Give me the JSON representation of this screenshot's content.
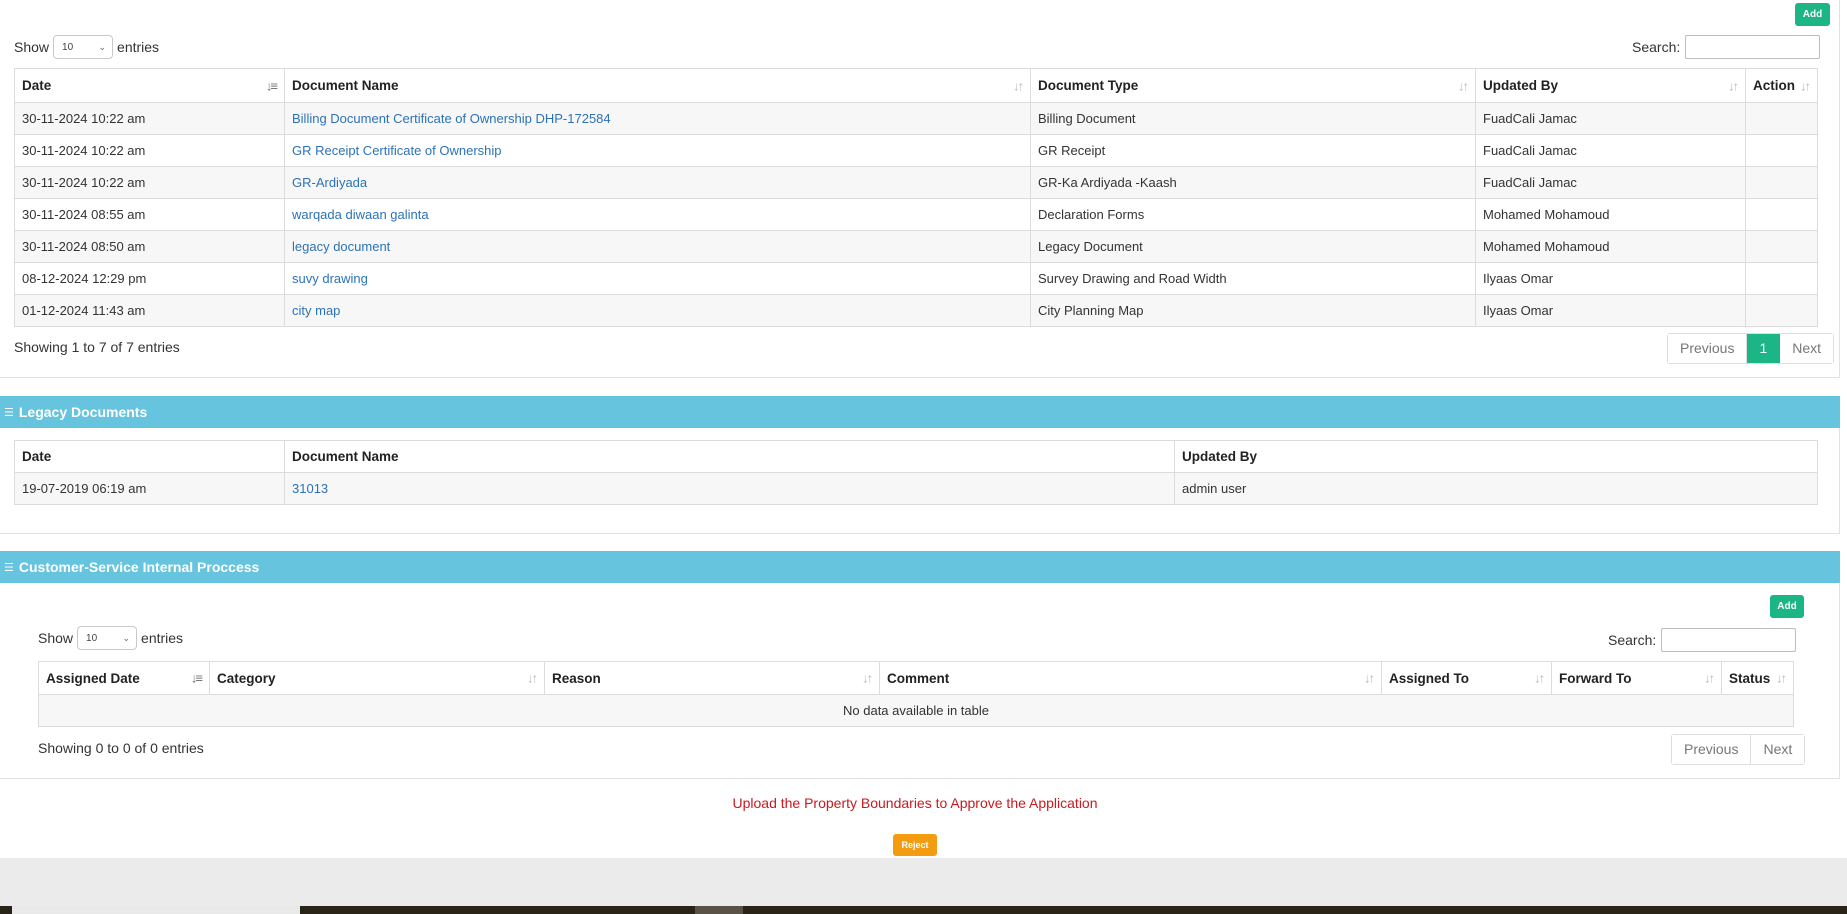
{
  "documents": {
    "add_label": "Add",
    "show_label": "Show",
    "page_size": "10",
    "entries_label": "entries",
    "search_label": "Search:",
    "columns": [
      "Date",
      "Document Name",
      "Document Type",
      "Updated By",
      "Action"
    ],
    "rows": [
      {
        "date": "30-11-2024 10:22 am",
        "name": "Billing Document Certificate of Ownership DHP-172584",
        "type": "Billing Document",
        "updated_by": "FuadCali Jamac",
        "action": ""
      },
      {
        "date": "30-11-2024 10:22 am",
        "name": "GR Receipt Certificate of Ownership",
        "type": "GR Receipt",
        "updated_by": "FuadCali Jamac",
        "action": ""
      },
      {
        "date": "30-11-2024 10:22 am",
        "name": "GR-Ardiyada",
        "type": "GR-Ka Ardiyada -Kaash",
        "updated_by": "FuadCali Jamac",
        "action": ""
      },
      {
        "date": "30-11-2024 08:55 am",
        "name": "warqada diwaan galinta",
        "type": "Declaration Forms",
        "updated_by": "Mohamed Mohamoud",
        "action": ""
      },
      {
        "date": "30-11-2024 08:50 am",
        "name": "legacy document",
        "type": "Legacy Document",
        "updated_by": "Mohamed Mohamoud",
        "action": ""
      },
      {
        "date": "08-12-2024 12:29 pm",
        "name": "suvy drawing",
        "type": "Survey Drawing and Road Width",
        "updated_by": "Ilyaas Omar",
        "action": ""
      },
      {
        "date": "01-12-2024 11:43 am",
        "name": "city map",
        "type": "City Planning Map",
        "updated_by": "Ilyaas Omar",
        "action": ""
      }
    ],
    "info": "Showing 1 to 7 of 7 entries",
    "pager": {
      "previous": "Previous",
      "current": "1",
      "next": "Next"
    }
  },
  "legacy": {
    "title": "Legacy Documents",
    "columns": [
      "Date",
      "Document Name",
      "Updated By"
    ],
    "rows": [
      {
        "date": "19-07-2019 06:19 am",
        "name": "31013",
        "updated_by": "admin user"
      }
    ]
  },
  "internal": {
    "title": "Customer-Service Internal Proccess",
    "add_label": "Add",
    "show_label": "Show",
    "page_size": "10",
    "entries_label": "entries",
    "search_label": "Search:",
    "columns": [
      "Assigned Date",
      "Category",
      "Reason",
      "Comment",
      "Assigned To",
      "Forward To",
      "Status"
    ],
    "empty_text": "No data available in table",
    "info": "Showing 0 to 0 of 0 entries",
    "pager": {
      "previous": "Previous",
      "next": "Next"
    }
  },
  "footer": {
    "warning": "Upload the Property Boundaries to Approve the Application",
    "reject_label": "Reject"
  },
  "colors": {
    "accent": "#1bb586",
    "panel": "#67c4de",
    "link": "#2d72b8",
    "warning": "#c9191e",
    "reject": "#f39c12"
  }
}
